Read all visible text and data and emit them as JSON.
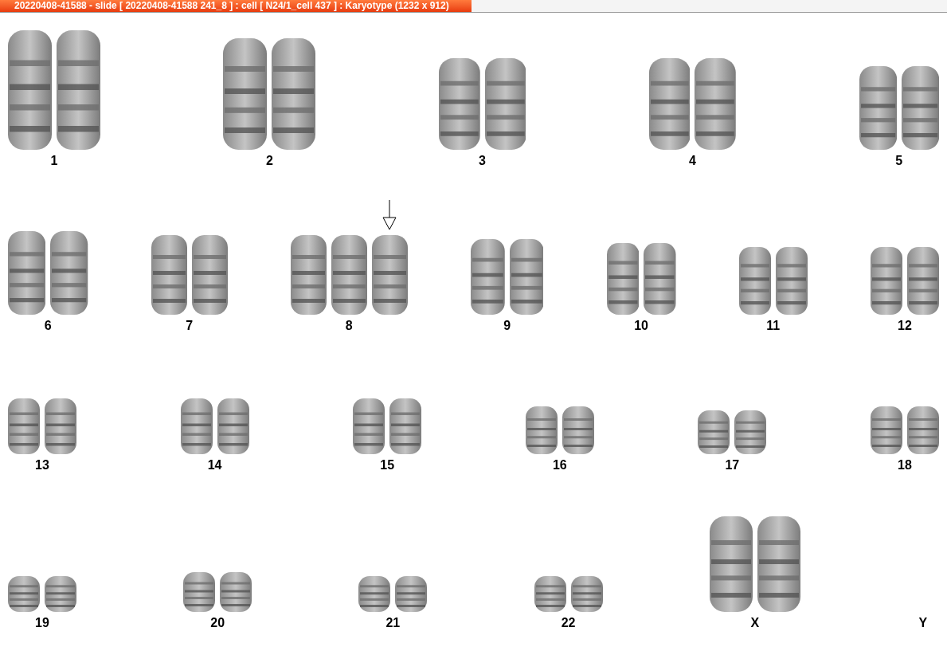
{
  "window": {
    "title": "20220408-41588 - slide [ 20220408-41588 241_8 ] : cell [ N24/1_cell 437 ] : Karyotype  (1232 x 912)"
  },
  "rows": [
    {
      "groups": [
        {
          "label": "1",
          "kind": "disomy",
          "marked": false
        },
        {
          "label": "2",
          "kind": "disomy",
          "marked": false
        },
        {
          "label": "3",
          "kind": "disomy",
          "marked": false
        },
        {
          "label": "4",
          "kind": "disomy",
          "marked": false
        },
        {
          "label": "5",
          "kind": "disomy",
          "marked": false
        }
      ]
    },
    {
      "groups": [
        {
          "label": "6",
          "kind": "disomy",
          "marked": false
        },
        {
          "label": "7",
          "kind": "disomy",
          "marked": false
        },
        {
          "label": "8",
          "kind": "trisomy",
          "marked": true
        },
        {
          "label": "9",
          "kind": "disomy",
          "marked": false
        },
        {
          "label": "10",
          "kind": "disomy",
          "marked": false
        },
        {
          "label": "11",
          "kind": "disomy",
          "marked": false
        },
        {
          "label": "12",
          "kind": "disomy",
          "marked": false
        }
      ]
    },
    {
      "groups": [
        {
          "label": "13",
          "kind": "disomy",
          "marked": false
        },
        {
          "label": "14",
          "kind": "disomy",
          "marked": false
        },
        {
          "label": "15",
          "kind": "disomy",
          "marked": false
        },
        {
          "label": "16",
          "kind": "disomy",
          "marked": false
        },
        {
          "label": "17",
          "kind": "disomy",
          "marked": false
        },
        {
          "label": "18",
          "kind": "disomy",
          "marked": false
        }
      ]
    },
    {
      "groups": [
        {
          "label": "19",
          "kind": "disomy",
          "marked": false
        },
        {
          "label": "20",
          "kind": "disomy",
          "marked": false
        },
        {
          "label": "21",
          "kind": "disomy",
          "marked": false
        },
        {
          "label": "22",
          "kind": "disomy",
          "marked": false
        },
        {
          "label": "X",
          "kind": "disomy",
          "marked": false
        },
        {
          "label": "Y",
          "kind": "absent",
          "marked": false
        }
      ]
    }
  ]
}
